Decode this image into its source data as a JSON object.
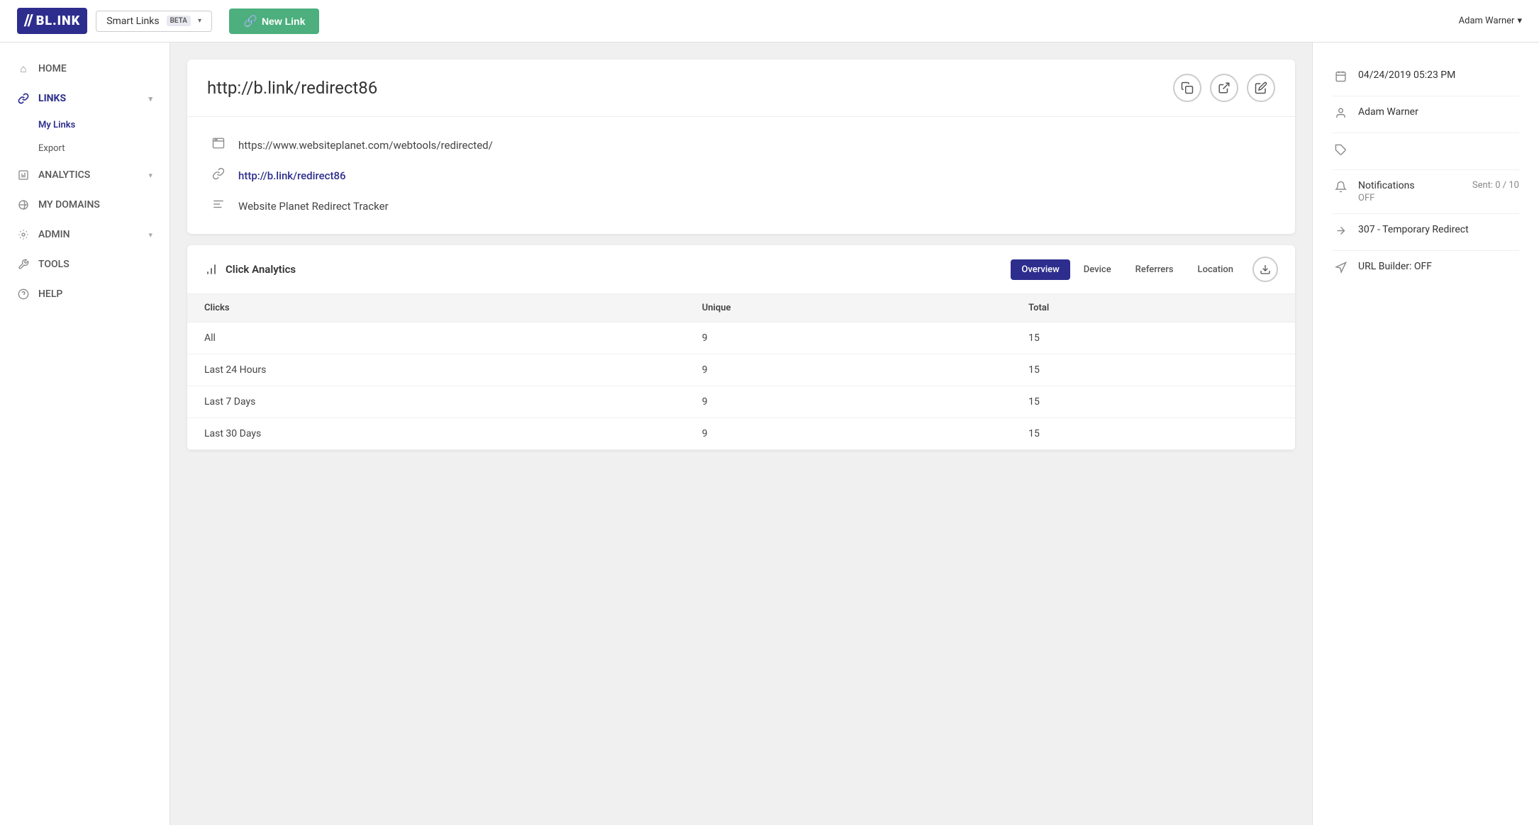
{
  "header": {
    "logo_text": "BL.INK",
    "smart_links_label": "Smart Links",
    "beta_label": "BETA",
    "new_link_label": "New Link",
    "user_label": "Adam Warner"
  },
  "sidebar": {
    "items": [
      {
        "id": "home",
        "label": "HOME",
        "icon": "⌂",
        "active": false
      },
      {
        "id": "links",
        "label": "LINKS",
        "icon": "🔗",
        "active": true,
        "expanded": true
      },
      {
        "id": "analytics",
        "label": "ANALYTICS",
        "icon": "📊",
        "active": false
      },
      {
        "id": "my-domains",
        "label": "MY DOMAINS",
        "icon": "◯",
        "active": false
      },
      {
        "id": "admin",
        "label": "ADMIN",
        "icon": "⚙",
        "active": false
      },
      {
        "id": "tools",
        "label": "TOOLS",
        "icon": "🔧",
        "active": false
      },
      {
        "id": "help",
        "label": "HELP",
        "icon": "?",
        "active": false
      }
    ],
    "sub_items": [
      {
        "id": "my-links",
        "label": "My Links",
        "active": true
      },
      {
        "id": "export",
        "label": "Export",
        "active": false
      }
    ]
  },
  "page": {
    "url": "http://b.link/redirect86",
    "destination_url": "https://www.websiteplanet.com/webtools/redirected/",
    "short_link": "http://b.link/redirect86",
    "title": "Website Planet Redirect Tracker",
    "actions": {
      "copy": "copy-icon",
      "external": "external-link-icon",
      "edit": "edit-icon"
    }
  },
  "analytics": {
    "title": "Click Analytics",
    "tabs": [
      {
        "id": "overview",
        "label": "Overview",
        "active": true
      },
      {
        "id": "device",
        "label": "Device",
        "active": false
      },
      {
        "id": "referrers",
        "label": "Referrers",
        "active": false
      },
      {
        "id": "location",
        "label": "Location",
        "active": false
      }
    ],
    "table": {
      "headers": [
        "Clicks",
        "Unique",
        "Total"
      ],
      "rows": [
        {
          "label": "All",
          "unique": "9",
          "total": "15"
        },
        {
          "label": "Last 24 Hours",
          "unique": "9",
          "total": "15"
        },
        {
          "label": "Last 7 Days",
          "unique": "9",
          "total": "15"
        },
        {
          "label": "Last 30 Days",
          "unique": "9",
          "total": "15"
        }
      ]
    }
  },
  "right_panel": {
    "date": "04/24/2019 05:23 PM",
    "owner": "Adam Warner",
    "tag": "",
    "notifications": {
      "label": "Notifications",
      "status": "OFF",
      "sent": "Sent: 0 / 10"
    },
    "redirect": "307 - Temporary Redirect",
    "url_builder": "URL Builder: OFF"
  }
}
